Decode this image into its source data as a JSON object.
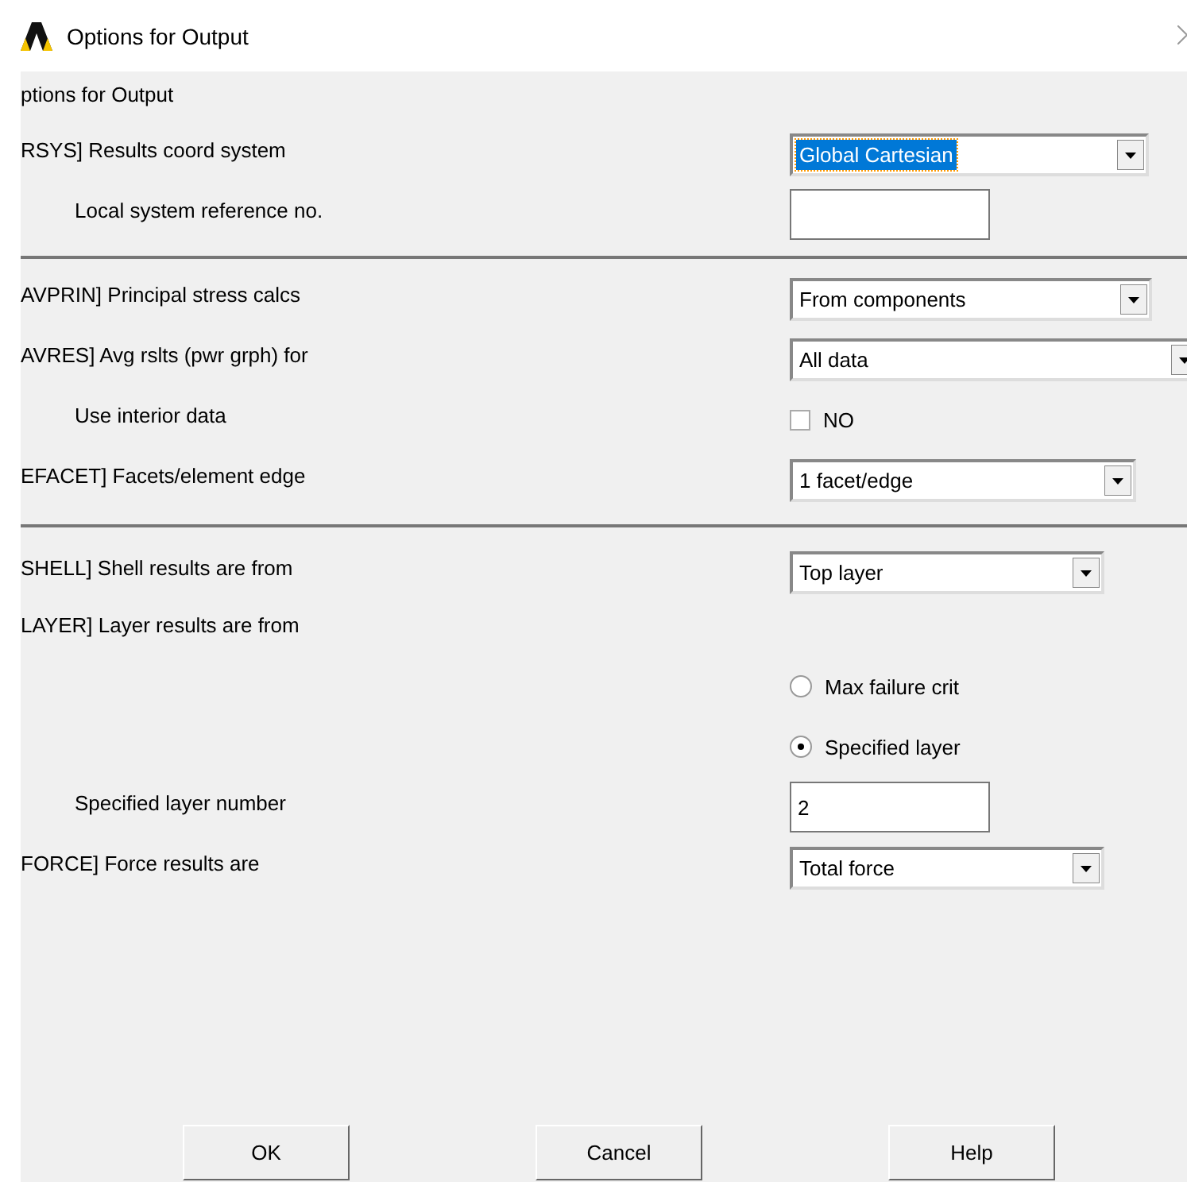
{
  "window": {
    "title": "Options for Output"
  },
  "rows": [
    {
      "kind": "heading",
      "label": "ptions for Output"
    },
    {
      "kind": "combo",
      "label": "RSYS]  Results coord system",
      "value": "Global Cartesian",
      "focused": true
    },
    {
      "kind": "input",
      "label": "Local system reference no.",
      "indented": true
    },
    {
      "kind": "divider"
    },
    {
      "kind": "combo",
      "label": "AVPRIN]  Principal stress calcs",
      "value": "From components",
      "focused": false
    },
    {
      "kind": "combo",
      "label": "AVRES] Avg rslts (pwr grph) for",
      "value": "All data",
      "focused": false
    },
    {
      "kind": "checkbox",
      "label": "Use interior data",
      "indented": true,
      "option": "NO",
      "checked": false
    },
    {
      "kind": "combo",
      "label": "EFACET]  Facets/element edge",
      "value": "1 facet/edge",
      "focused": false
    },
    {
      "kind": "divider"
    },
    {
      "kind": "combo",
      "label": "SHELL]  Shell results are from",
      "value": "Top layer",
      "focused": false
    },
    {
      "kind": "heading",
      "label": "LAYER]  Layer results are from"
    },
    {
      "kind": "radio",
      "option": "Max failure crit",
      "selected": false
    },
    {
      "kind": "radio",
      "option": "Specified layer",
      "selected": true
    },
    {
      "kind": "input",
      "label": "Specified layer number",
      "indented": true,
      "value": "2"
    },
    {
      "kind": "combo",
      "label": "FORCE]  Force results are",
      "value": "Total force",
      "focused": false
    }
  ],
  "buttons": [
    "OK",
    "Cancel",
    "Help"
  ]
}
